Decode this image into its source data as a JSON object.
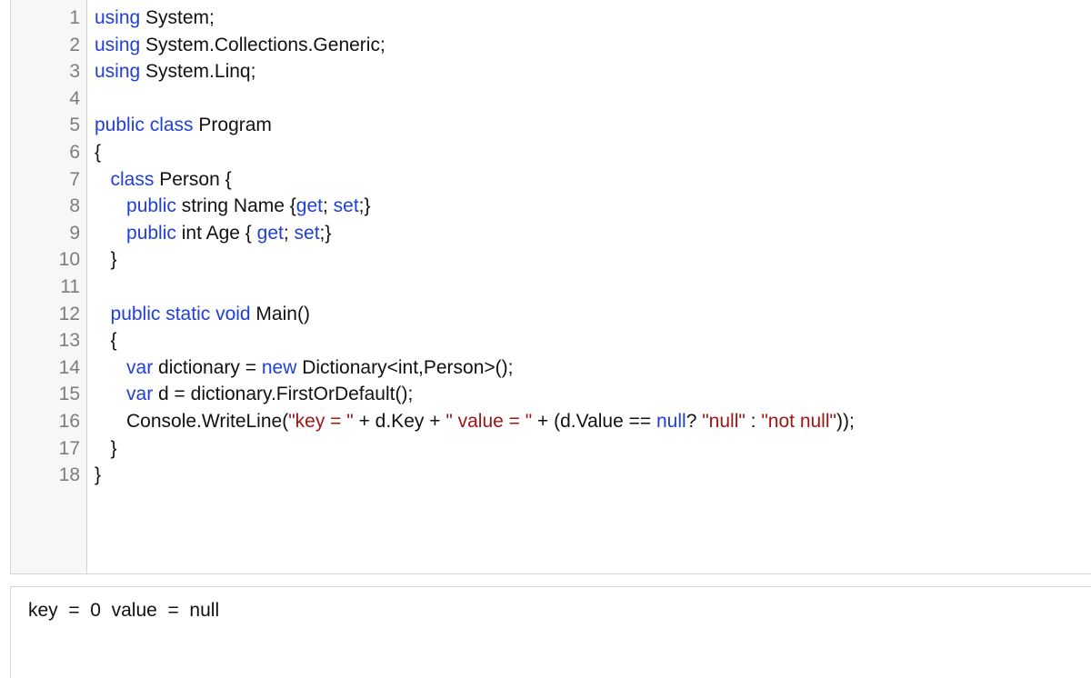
{
  "editor": {
    "lines": [
      {
        "number": "1",
        "t0": "using",
        "t1": " System;"
      },
      {
        "number": "2",
        "t0": "using",
        "t1": " System.Collections.Generic;"
      },
      {
        "number": "3",
        "t0": "using",
        "t1": " System.Linq;"
      },
      {
        "number": "4"
      },
      {
        "number": "5",
        "t0": "public class",
        "t1": " Program"
      },
      {
        "number": "6",
        "t0": "{"
      },
      {
        "number": "7",
        "t0": "   ",
        "t1": "class",
        "t2": " Person {"
      },
      {
        "number": "8",
        "t0": "      ",
        "t1": "public",
        "t2": " string Name {",
        "t3": "get",
        "t4": "; ",
        "t5": "set",
        "t6": ";}"
      },
      {
        "number": "9",
        "t0": "      ",
        "t1": "public",
        "t2": " int Age { ",
        "t3": "get",
        "t4": "; ",
        "t5": "set",
        "t6": ";}"
      },
      {
        "number": "10",
        "t0": "   }"
      },
      {
        "number": "11"
      },
      {
        "number": "12",
        "t0": "   ",
        "t1": "public static void",
        "t2": " Main()"
      },
      {
        "number": "13",
        "t0": "   {"
      },
      {
        "number": "14",
        "t0": "      ",
        "t1": "var",
        "t2": " dictionary = ",
        "t3": "new",
        "t4": " Dictionary<int,Person>();"
      },
      {
        "number": "15",
        "t0": "      ",
        "t1": "var",
        "t2": " d = dictionary.FirstOrDefault();"
      },
      {
        "number": "16",
        "t0": "      Console.WriteLine(",
        "t1": "\"key = \"",
        "t2": " + d.Key + ",
        "t3": "\" value = \"",
        "t4": " + (d.Value == ",
        "t5": "null",
        "t6": "? ",
        "t7": "\"null\"",
        "t8": " : ",
        "t9": "\"not null\"",
        "t10": "));"
      },
      {
        "number": "17",
        "t0": "   }"
      },
      {
        "number": "18",
        "t0": "}"
      }
    ]
  },
  "output": {
    "text": "key  =  0  value  =  null"
  }
}
